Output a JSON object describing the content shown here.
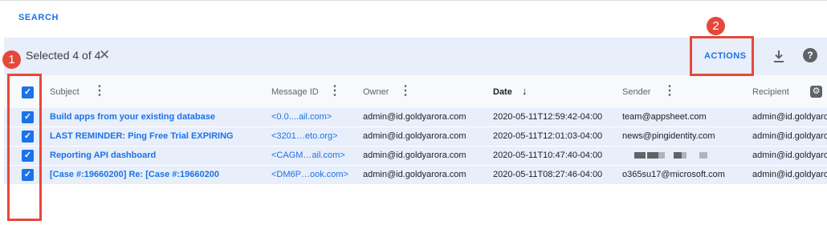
{
  "search": {
    "label": "SEARCH"
  },
  "selection": {
    "text": "Selected 4 of 4",
    "close_glyph": "✕"
  },
  "toolbar": {
    "actions_label": "ACTIONS",
    "download_icon": "download-icon",
    "help_glyph": "?"
  },
  "columns": {
    "subject": "Subject",
    "message_id": "Message ID",
    "owner": "Owner",
    "date": "Date",
    "sender": "Sender",
    "recipient": "Recipient"
  },
  "rows": [
    {
      "subject": "Build apps from your existing database",
      "message_id": "<0.0....ail.com>",
      "owner": "admin@id.goldyarora.com",
      "date": "2020-05-11T12:59:42-04:00",
      "sender": "team@appsheet.com",
      "recipient": "admin@id.goldyaror"
    },
    {
      "subject": "LAST REMINDER: Ping Free Trial EXPIRING",
      "message_id": "<3201…eto.org>",
      "owner": "admin@id.goldyarora.com",
      "date": "2020-05-11T12:01:03-04:00",
      "sender": "news@pingidentity.com",
      "recipient": "admin@id.goldyaror"
    },
    {
      "subject": "Reporting API dashboard",
      "message_id": "<CAGM…ail.com>",
      "owner": "admin@id.goldyarora.com",
      "date": "2020-05-11T10:47:40-04:00",
      "sender": "",
      "recipient": "admin@id.goldyaror"
    },
    {
      "subject": "[Case #:19660200] Re: [Case #:19660200",
      "message_id": "<DM6P…ook.com>",
      "owner": "admin@id.goldyarora.com",
      "date": "2020-05-11T08:27:46-04:00",
      "sender": "o365su17@microsoft.com",
      "recipient": "admin@id.goldyaror"
    }
  ],
  "annotations": [
    "1",
    "2"
  ],
  "colors": {
    "accent": "#1a73e8",
    "selection_bg": "#e8eefa",
    "annotation": "#e5483b"
  }
}
